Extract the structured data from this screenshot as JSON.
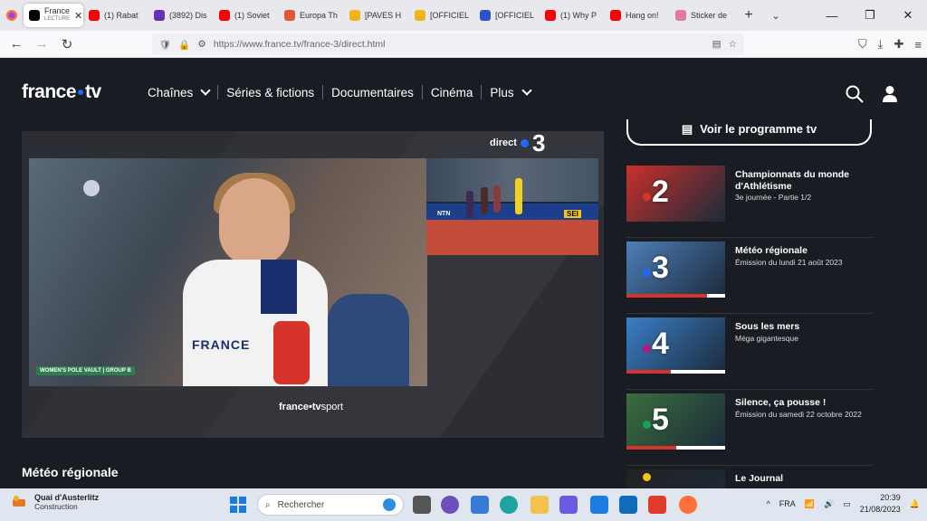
{
  "browser": {
    "tabs": [
      {
        "label": "France",
        "sublabel": "LECTURE",
        "icon": "france-tv-icon",
        "color": "#000000",
        "active": true
      },
      {
        "label": "(1) Rabat",
        "icon": "youtube-icon",
        "color": "#ff0000"
      },
      {
        "label": "(3892) Dis",
        "icon": "streaming-icon",
        "color": "#6b2fb3"
      },
      {
        "label": "(1) Soviet",
        "icon": "youtube-icon",
        "color": "#ff0000"
      },
      {
        "label": "Europa Th",
        "icon": "radio-icon",
        "color": "#e0573a"
      },
      {
        "label": "[PAVES H",
        "icon": "emoji-icon",
        "color": "#f2b21a"
      },
      {
        "label": "[OFFICIEL",
        "icon": "emoji-icon",
        "color": "#f2b21a"
      },
      {
        "label": "[OFFICIEL",
        "icon": "j-icon",
        "color": "#2a55c9"
      },
      {
        "label": "(1) Why P",
        "icon": "youtube-icon",
        "color": "#ff0000"
      },
      {
        "label": "Hang on!",
        "icon": "youtube-icon",
        "color": "#ff0000"
      },
      {
        "label": "Sticker de",
        "icon": "sticker-icon",
        "color": "#e07aa5"
      }
    ],
    "new_tab": "+",
    "url": "https://www.france.tv/france-3/direct.html"
  },
  "site": {
    "logo_left": "france",
    "logo_right": "tv",
    "nav": [
      {
        "label": "Chaînes",
        "dropdown": true
      },
      {
        "label": "Séries & fictions",
        "dropdown": false
      },
      {
        "label": "Documentaires",
        "dropdown": false
      },
      {
        "label": "Cinéma",
        "dropdown": false
      },
      {
        "label": "Plus",
        "dropdown": true
      }
    ]
  },
  "player": {
    "direct_label": "direct",
    "channel_number": "3",
    "lower_third": "WOMEN'S POLE VAULT | GROUP B",
    "jersey_text": "FRANCE",
    "pip_ntn": "NTN",
    "pip_sign": "SEI",
    "sport_logo_main": "france•tv",
    "sport_logo_sub": "sport"
  },
  "section_title": "Météo régionale",
  "program_button": "Voir le programme tv",
  "channels": [
    {
      "number": "2",
      "title": "Championnats du monde d'Athlétisme",
      "subtitle": "3e journée - Partie 1/2",
      "progress": 0,
      "dot_color": "#d8332b",
      "thumb_color": "#c8312a"
    },
    {
      "number": "3",
      "title": "Météo régionale",
      "subtitle": "Émission du lundi 21 août 2023",
      "progress": 0.82,
      "dot_color": "#1c6cf3",
      "thumb_color": "#4d7fb6"
    },
    {
      "number": "4",
      "title": "Sous les mers",
      "subtitle": "Méga gigantesque",
      "progress": 0.45,
      "dot_color": "#b7197e",
      "thumb_color": "#3b7fc8"
    },
    {
      "number": "5",
      "title": "Silence, ça pousse !",
      "subtitle": "Émission du samedi 22 octobre 2022",
      "progress": 0.5,
      "dot_color": "#1aa05a",
      "thumb_color": "#3a6f3c"
    },
    {
      "number": "",
      "title": "Le Journal",
      "subtitle": "",
      "progress": 0,
      "dot_color": "#f5c518",
      "thumb_color": "#222222"
    }
  ],
  "taskbar": {
    "weather_title": "Quai d'Austerlitz",
    "weather_sub": "Construction",
    "search_placeholder": "Rechercher",
    "lang": "FRA",
    "time": "20:39",
    "date": "21/08/2023"
  }
}
